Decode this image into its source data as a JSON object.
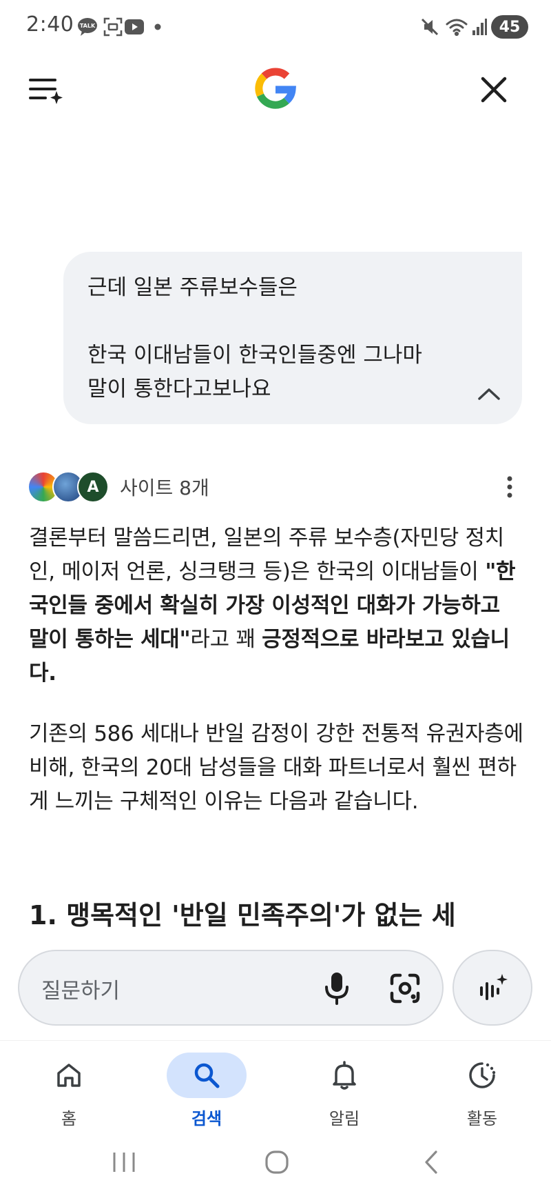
{
  "status_bar": {
    "time": "2:40",
    "battery": "45",
    "left_icons": [
      "talk-icon",
      "screenshot-icon",
      "youtube-icon",
      "dot-icon"
    ],
    "right_icons": [
      "mute-icon",
      "wifi-icon",
      "signal-icon"
    ]
  },
  "header": {
    "menu_icon": "menu-sparkle-icon",
    "logo": "google-g-logo",
    "close_icon": "close-icon"
  },
  "query": {
    "lines": [
      "근데 일본 주류보수들은",
      "",
      "한국 이대남들이 한국인들중엔 그나마",
      "말이 통한다고보나요"
    ],
    "collapse_icon": "chevron-up-icon"
  },
  "sources": {
    "label": "사이트 8개",
    "avatars": [
      "source-avatar-1",
      "source-avatar-2",
      "source-avatar-3"
    ],
    "avatar3_letter": "A"
  },
  "answer": {
    "para1_plain": "결론부터 말씀드리면, 일본의 주류 보수층(자민당 정치인, 메이저 언론, 싱크탱크 등)은 한국의 이대남들이 ",
    "para1_bold1": "\"한국인들 중에서 확실히 가장 이성적인 대화가 가능하고 말이 통하는 세대\"",
    "para1_mid": "라고 꽤 ",
    "para1_bold2": "긍정적으로 바라보고 있습니다.",
    "para2": "기존의 586 세대나 반일 감정이 강한 전통적 유권자층에 비해, 한국의 20대 남성들을 대화 파트너로서 훨씬 편하게 느끼는 구체적인 이유는 다음과 같습니다.",
    "heading": "1. 맹목적인 '반일 민족주의'가 없는 세"
  },
  "ask_bar": {
    "placeholder": "질문하기",
    "mic_icon": "mic-icon",
    "lens_icon": "lens-icon",
    "ai_icon": "ai-mode-icon"
  },
  "bottom_nav": {
    "items": [
      {
        "label": "홈",
        "icon": "home-icon"
      },
      {
        "label": "검색",
        "icon": "search-icon",
        "active": true
      },
      {
        "label": "알림",
        "icon": "bell-icon"
      },
      {
        "label": "활동",
        "icon": "activity-icon"
      }
    ]
  },
  "colors": {
    "accent": "#0b57d0",
    "active_pill": "#d3e3fd",
    "bubble": "#f0f2f5"
  }
}
